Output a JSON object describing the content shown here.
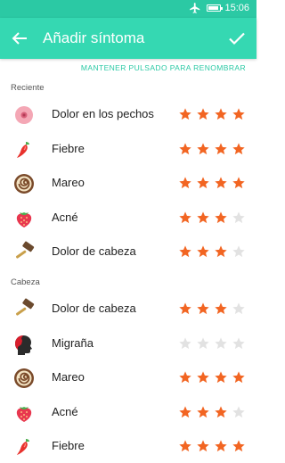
{
  "status_bar": {
    "time": "15:06",
    "icons": [
      "airplane-icon",
      "battery-icon"
    ]
  },
  "app_bar": {
    "title": "Añadir síntoma",
    "back_icon": "arrow-back-icon",
    "confirm_icon": "check-icon"
  },
  "hint": "MANTENER PULSADO PARA RENOMBRAR",
  "rating_max": 4,
  "colors": {
    "accent": "#35d8b2",
    "status_bar": "#2bc9a4",
    "star_on": "#f26522",
    "star_off": "#e2e2e2"
  },
  "sections": [
    {
      "header": "Reciente",
      "items": [
        {
          "label": "Dolor en los pechos",
          "icon": "breast-icon",
          "rating": 4
        },
        {
          "label": "Fiebre",
          "icon": "chili-pepper-icon",
          "rating": 4
        },
        {
          "label": "Mareo",
          "icon": "spiral-roll-icon",
          "rating": 4
        },
        {
          "label": "Acné",
          "icon": "strawberry-icon",
          "rating": 3
        },
        {
          "label": "Dolor de cabeza",
          "icon": "hammer-icon",
          "rating": 3
        }
      ]
    },
    {
      "header": "Cabeza",
      "items": [
        {
          "label": "Dolor de cabeza",
          "icon": "hammer-icon",
          "rating": 3
        },
        {
          "label": "Migraña",
          "icon": "head-profile-icon",
          "rating": 0
        },
        {
          "label": "Mareo",
          "icon": "spiral-roll-icon",
          "rating": 4
        },
        {
          "label": "Acné",
          "icon": "strawberry-icon",
          "rating": 3
        },
        {
          "label": "Fiebre",
          "icon": "chili-pepper-icon",
          "rating": 4
        }
      ]
    }
  ]
}
